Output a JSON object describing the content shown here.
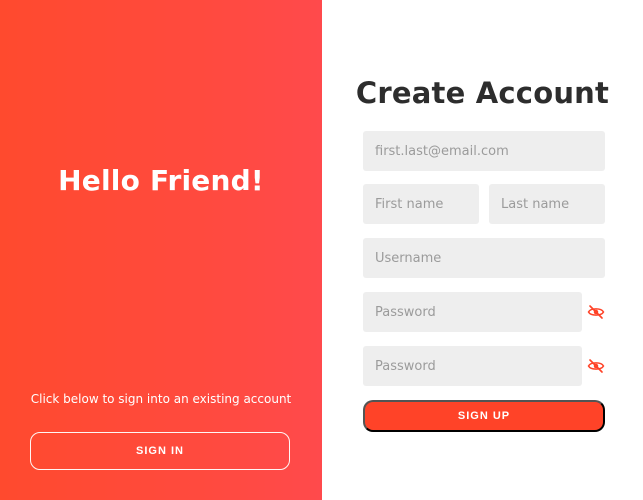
{
  "colors": {
    "accent": "#ff4328",
    "left_gradient_start": "#ff4a2e",
    "left_gradient_end": "#ff4a4c",
    "input_bg": "#eeeeee",
    "title_text": "#2d2d2d"
  },
  "left": {
    "title": "Hello Friend!",
    "hint": "Click below to sign into an existing account",
    "signin_label": "SIGN IN"
  },
  "form": {
    "title": "Create Account",
    "email_placeholder": "first.last@email.com",
    "first_name_placeholder": "First name",
    "last_name_placeholder": "Last name",
    "username_placeholder": "Username",
    "password_placeholder": "Password",
    "confirm_password_placeholder": "Password",
    "password_toggle_icon": "eye-slash-icon",
    "signup_label": "SIGN UP"
  }
}
